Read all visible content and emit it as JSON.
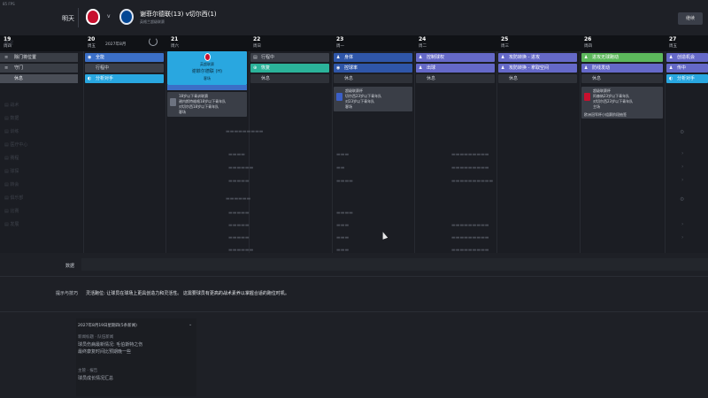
{
  "top": {
    "fps": "85 FPS",
    "tomorrow_label": "明天",
    "vs": "v",
    "match_title": "谢菲尔德联(13) v切尔西(1)",
    "match_subtitle": "英格兰超级联赛",
    "continue_label": "继续"
  },
  "days": [
    {
      "num": "19",
      "weekday": "周四"
    },
    {
      "num": "20",
      "weekday": "周五",
      "month": "2027年8月"
    },
    {
      "num": "21",
      "weekday": "周六"
    },
    {
      "num": "22",
      "weekday": "周日"
    },
    {
      "num": "23",
      "weekday": "周一"
    },
    {
      "num": "24",
      "weekday": "周二"
    },
    {
      "num": "25",
      "weekday": "周三"
    },
    {
      "num": "26",
      "weekday": "周四"
    },
    {
      "num": "27",
      "weekday": "周五"
    }
  ],
  "left_menu": [
    {
      "label": "除门将位置",
      "icon": "≡"
    },
    {
      "label": "守门",
      "icon": "≡"
    },
    {
      "label": "休息",
      "icon": ""
    }
  ],
  "slots": {
    "d20": [
      "全能",
      "行程中",
      "分析对手"
    ],
    "d22": [
      "行程中",
      "恢复",
      "休息"
    ],
    "d23": [
      "身体",
      "控球率",
      "休息"
    ],
    "d24": [
      "控制球权",
      "出球",
      "休息"
    ],
    "d25": [
      "攻防转换 - 进攻",
      "攻防转换 - 拿取空间",
      "休息"
    ],
    "d26": [
      "进攻无球跑动",
      "防线发动",
      "休息"
    ],
    "d27": [
      "创造机会",
      "传中",
      "分析对手"
    ]
  },
  "match_card": {
    "competition": "英超联赛",
    "teams": "谢菲尔德联 (H)",
    "venue": "客场"
  },
  "info_cards": {
    "d21": {
      "l1": "18岁以下青训联赛",
      "l2": "谢内斯特维格18岁以下青年队",
      "l3": "对切尔西18岁以下青年队",
      "l4": "客场"
    },
    "d23": {
      "l1": "超级联赛杯",
      "l2": "切尔西23岁以下青年队",
      "l3": "对23岁以下青年队",
      "l4": "客场"
    },
    "d26": {
      "l1": "超级联赛杯",
      "l2": "阿森纳23岁以下青年队",
      "l3": "对切尔西23岁以下青年队",
      "l4": "主场",
      "l5": "欧洲冠军杯小组赛阶段抽签"
    }
  },
  "lower": {
    "data_label": "数据",
    "tips_label": "提示与技巧",
    "tips_text": "灵活跑位: 让球员在球场上更具创造力和灵活性。 这需要球员有更高的战术素养以掌握合适的跑位时机。",
    "news_header": "2027年8月19日星期四(5条新闻)",
    "news": [
      {
        "meta": "新闻标题 · 队伍新闻",
        "body1": "球员伤病最新情况: 毛伯斯特之伤",
        "body2": "最终康复时间比预期晚一些"
      },
      {
        "meta": "主管 · 报告",
        "body1": "球员成长情况汇总"
      }
    ]
  }
}
